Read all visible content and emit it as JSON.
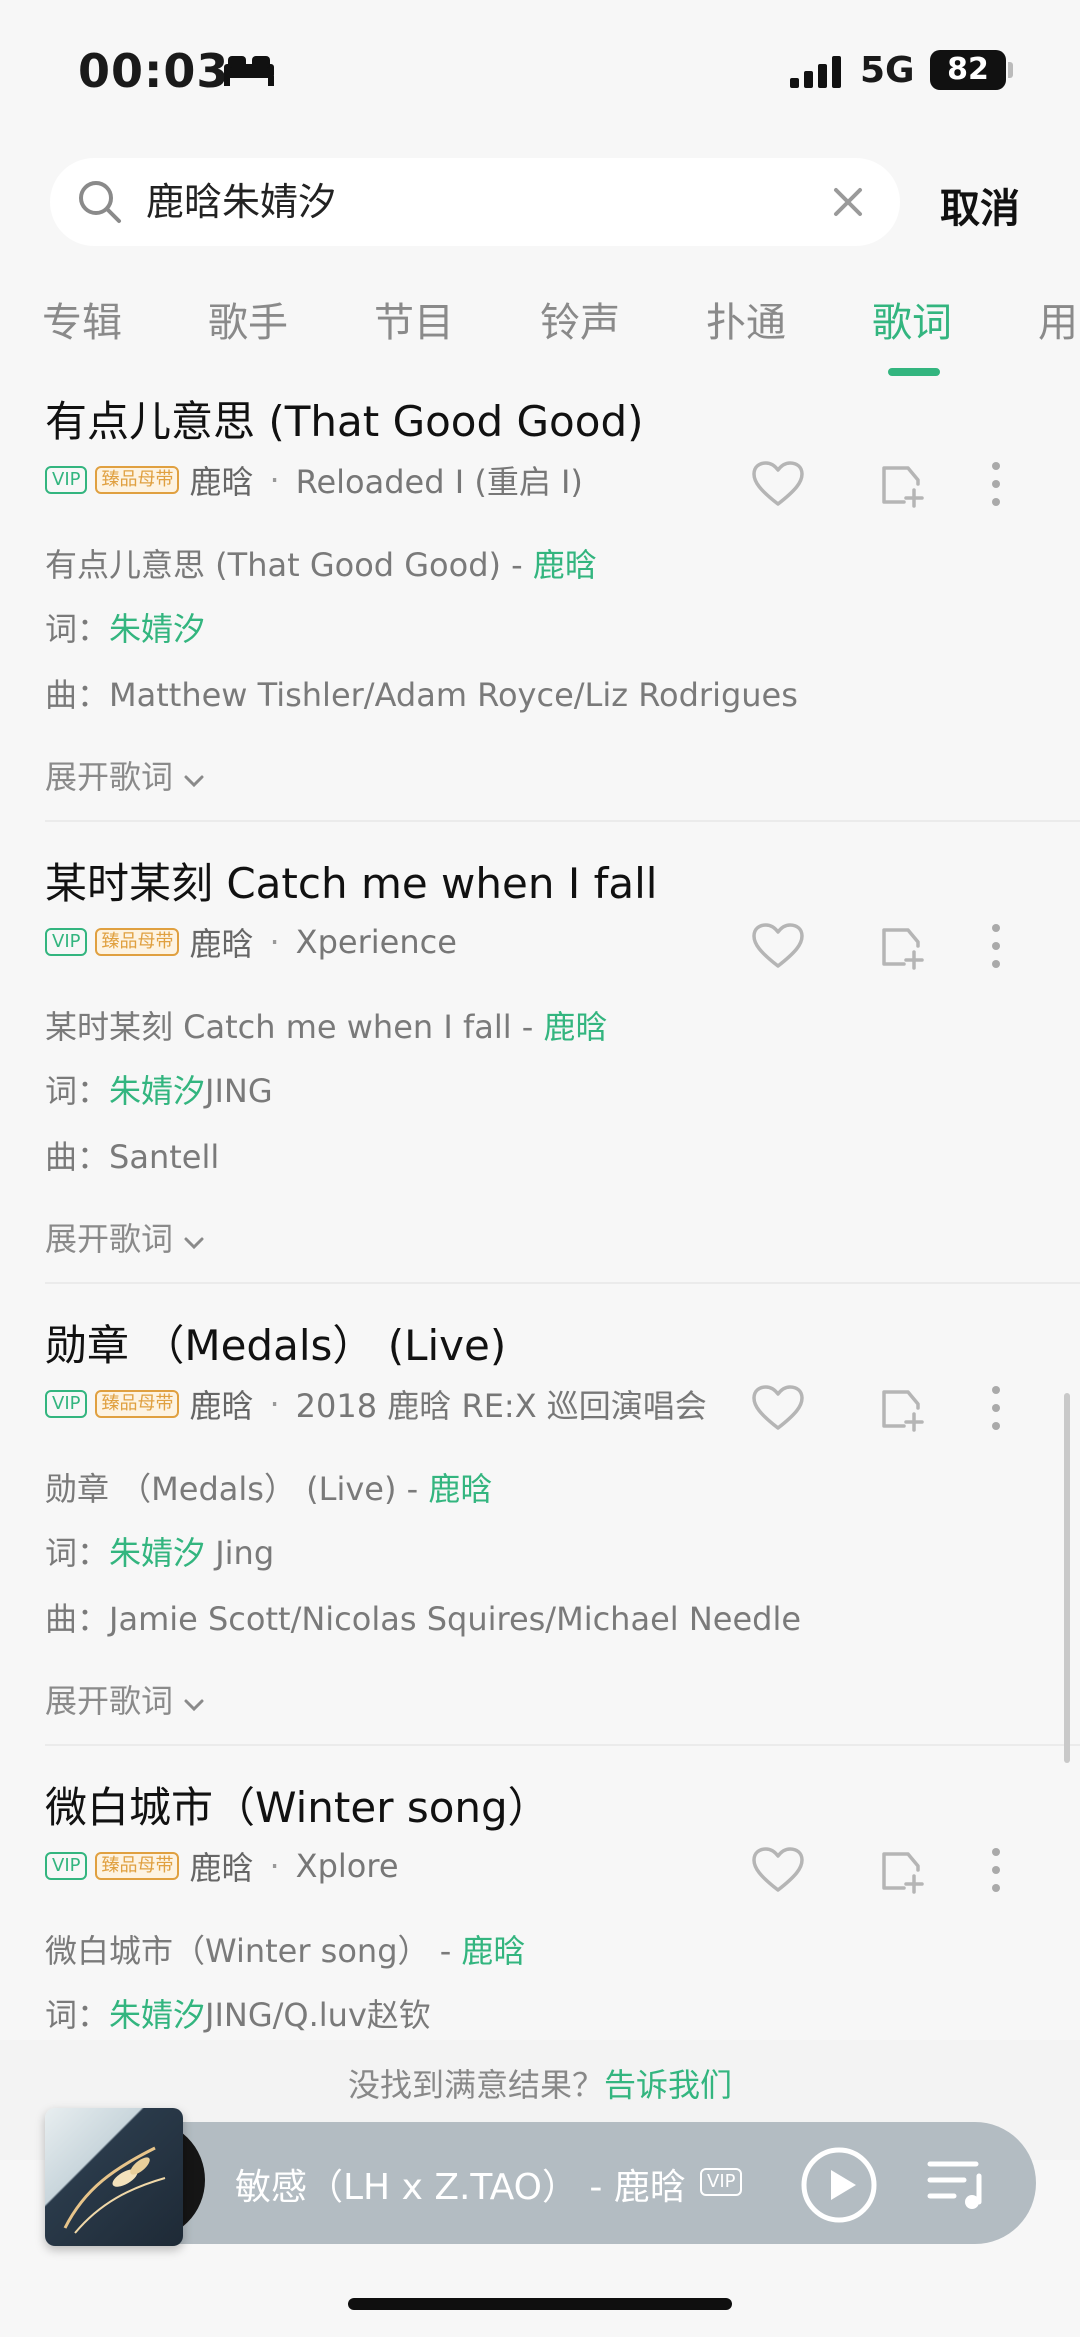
{
  "status": {
    "time": "00:03",
    "network": "5G",
    "battery": "82"
  },
  "search": {
    "query": "鹿晗朱婧汐",
    "cancel": "取消"
  },
  "tabs": [
    {
      "label": "专辑"
    },
    {
      "label": "歌手"
    },
    {
      "label": "节目"
    },
    {
      "label": "铃声"
    },
    {
      "label": "扑通"
    },
    {
      "label": "歌词",
      "active": true
    },
    {
      "label": "用"
    }
  ],
  "badges": {
    "vip": "VIP",
    "hq": "臻品母带"
  },
  "labels": {
    "lyricist": "词：",
    "composer": "曲：",
    "expand": "展开歌词",
    "separator": "·"
  },
  "results": [
    {
      "title": "有点儿意思 (That Good Good)",
      "artist": "鹿晗",
      "album": "Reloaded I (重启 I)",
      "song_line": "有点儿意思 (That Good Good) - ",
      "song_artist": "鹿晗",
      "lyricist_hl": "朱婧汐",
      "lyricist_rest": "",
      "composer": "Matthew Tishler/Adam Royce/Liz Rodrigues"
    },
    {
      "title": "某时某刻 Catch me when I fall",
      "artist": "鹿晗",
      "album": "Xperience",
      "song_line": "某时某刻 Catch me when I fall - ",
      "song_artist": "鹿晗",
      "lyricist_hl": "朱婧汐",
      "lyricist_rest": "JING",
      "composer": "Santell"
    },
    {
      "title": "勋章 （Medals） (Live)",
      "artist": "鹿晗",
      "album": "2018 鹿晗 RE:X 巡回演唱会",
      "song_line": "勋章 （Medals） (Live) - ",
      "song_artist": "鹿晗",
      "lyricist_hl": "朱婧汐",
      "lyricist_rest": " Jing",
      "composer": "Jamie Scott/Nicolas Squires/Michael Needle"
    },
    {
      "title": "微白城市（Winter song）",
      "artist": "鹿晗",
      "album": "Xplore",
      "song_line": "微白城市（Winter song） - ",
      "song_artist": "鹿晗",
      "lyricist_hl": "朱婧汐",
      "lyricist_rest": "JING/Q.luv赵钦"
    }
  ],
  "footer": {
    "prompt": "没找到满意结果？",
    "feedback_link": "告诉我们"
  },
  "player": {
    "now_playing": "敏感（LH x Z.TAO） - 鹿晗",
    "vip": "VIP"
  },
  "colors": {
    "accent": "#33b57f",
    "hq_badge": "#e0a040",
    "player_bg": "#b3bcc2"
  },
  "icons": [
    "sleep-icon",
    "signal-icon",
    "search-icon",
    "clear-icon",
    "heart-icon",
    "add-to-playlist-icon",
    "more-icon",
    "chevron-down-icon",
    "play-icon",
    "playlist-icon"
  ]
}
